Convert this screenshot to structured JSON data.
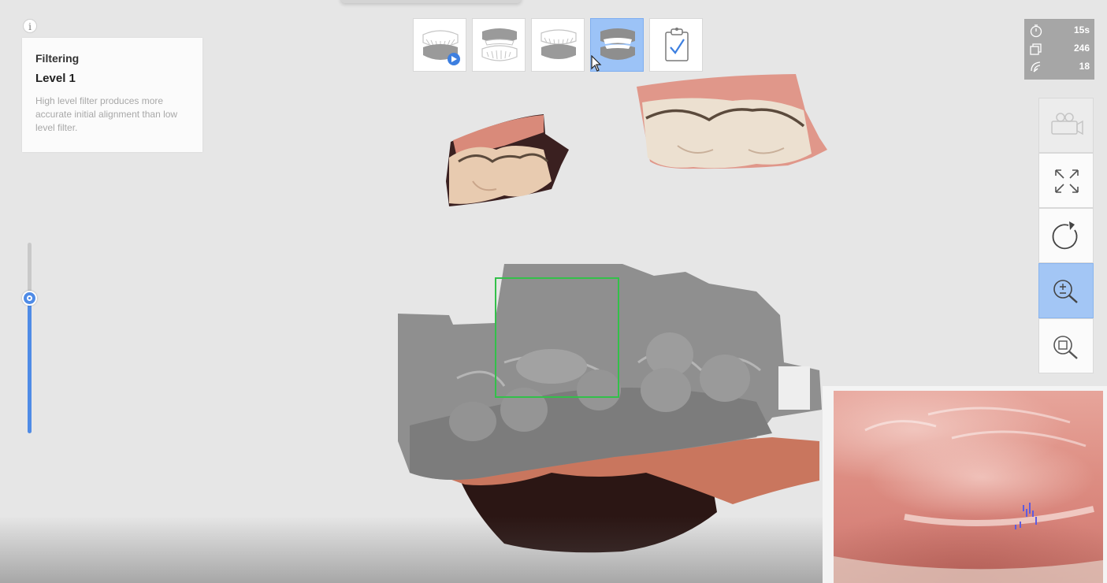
{
  "info": {
    "icon_label": "i"
  },
  "filter_panel": {
    "title": "Filtering",
    "level": "Level 1",
    "description": "High level filter produces more accurate initial alignment than low level filter."
  },
  "filter_slider": {
    "level_fraction": 0.71
  },
  "stage_toolbar": [
    {
      "name": "upper-jaw-stage",
      "icon": "upper-jaw-scan-icon",
      "active": false
    },
    {
      "name": "lower-jaw-stage",
      "icon": "lower-jaw-icon",
      "active": false
    },
    {
      "name": "bite-stage",
      "icon": "bite-icon",
      "active": false
    },
    {
      "name": "occlusion-stage",
      "icon": "occlusion-icon",
      "active": true
    },
    {
      "name": "complete-stage",
      "icon": "clipboard-check-icon",
      "active": false
    }
  ],
  "stats": [
    {
      "icon": "timer-icon",
      "value": "15s"
    },
    {
      "icon": "frames-icon",
      "value": "246"
    },
    {
      "icon": "speed-icon",
      "value": "18"
    }
  ],
  "right_tools": [
    {
      "name": "camera-tool",
      "icon": "camera-icon",
      "state": "disabled"
    },
    {
      "name": "fit-view-tool",
      "icon": "expand-arrows-icon",
      "state": "normal"
    },
    {
      "name": "reset-rotation-tool",
      "icon": "rotate-icon",
      "state": "normal"
    },
    {
      "name": "zoom-tool",
      "icon": "zoom-plus-minus-icon",
      "state": "active"
    },
    {
      "name": "zoom-area-tool",
      "icon": "zoom-area-icon",
      "state": "normal"
    }
  ],
  "colors": {
    "accent_blue": "#4f8be6",
    "active_button": "#9cc3f7",
    "selection_green": "#33c04a",
    "stats_bg": "#a6a6a6"
  }
}
